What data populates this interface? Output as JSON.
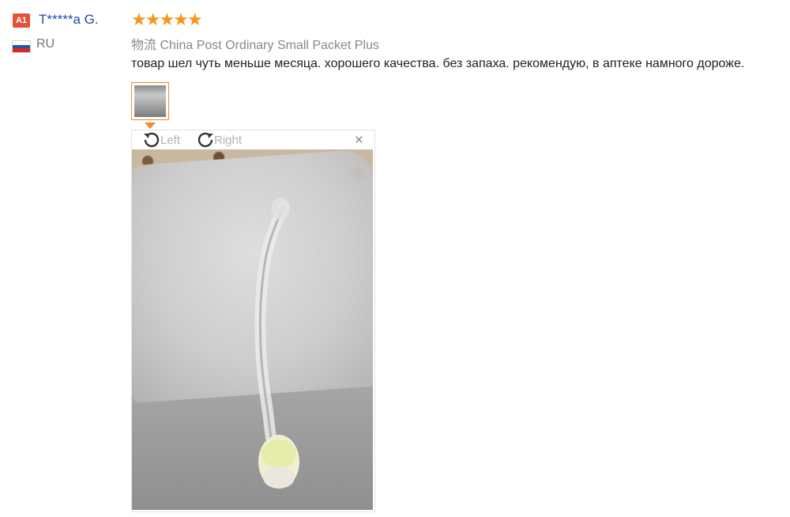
{
  "reviewer": {
    "badge": "A1",
    "name": "T*****a G.",
    "country": "RU"
  },
  "review": {
    "rating": 5,
    "stars": "★★★★★",
    "shipping": "物流 China Post Ordinary Small Packet Plus",
    "text": "товар шел чуть меньше месяца. хорошего качества. без запаха. рекомендую, в аптеке намного дороже."
  },
  "viewer": {
    "rotate_left_label": "Left",
    "rotate_right_label": "Right",
    "close_label": "×"
  },
  "colors": {
    "accent": "#f28a2b",
    "star": "#f7941d",
    "name": "#1f4ea8",
    "badge": "#e4513a"
  },
  "icons": [
    "rotate-left-icon",
    "rotate-right-icon",
    "close-icon",
    "russia-flag-icon"
  ]
}
